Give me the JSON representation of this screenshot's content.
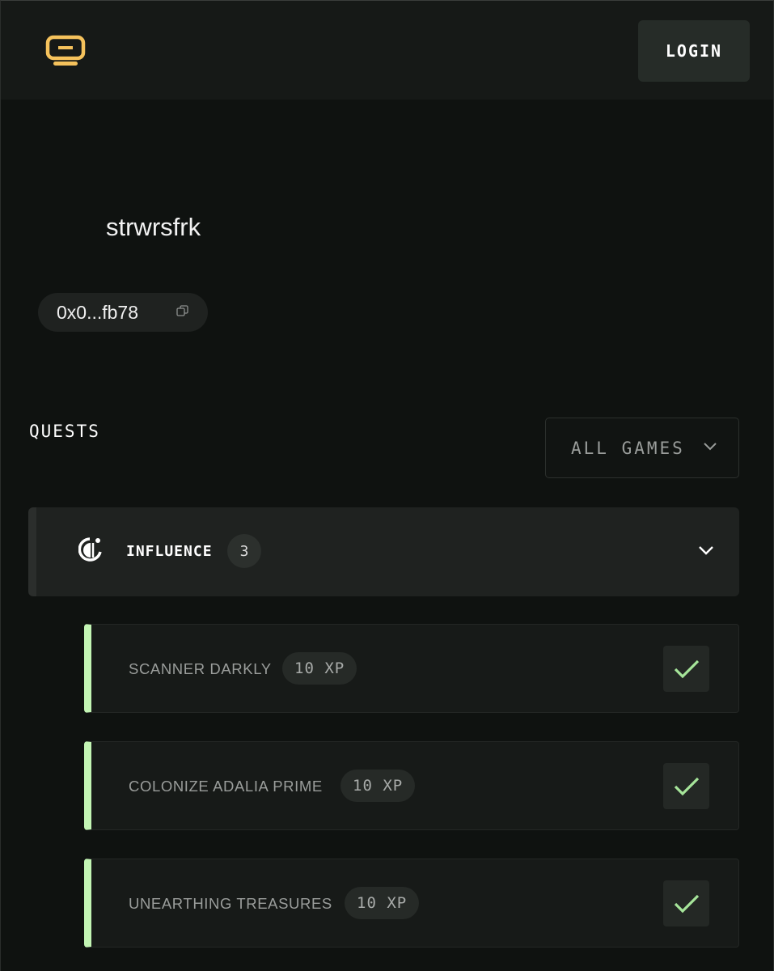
{
  "header": {
    "logo_icon": "monitor-logo-icon",
    "login_label": "LOGIN",
    "accent_color": "#f5c25c"
  },
  "profile": {
    "username": "strwrsfrk",
    "wallet_address": "0x0...fb78",
    "copy_icon": "copy-icon"
  },
  "quests": {
    "title": "QUESTS",
    "filter_label": "ALL GAMES",
    "groups": [
      {
        "name": "INFLUENCE",
        "count": "3",
        "icon": "influence-logo-icon",
        "items": [
          {
            "name": "SCANNER DARKLY",
            "xp": "10 XP",
            "completed": true
          },
          {
            "name": "COLONIZE ADALIA PRIME",
            "xp": "10 XP",
            "completed": true
          },
          {
            "name": "UNEARTHING TREASURES",
            "xp": "10 XP",
            "completed": true
          }
        ]
      }
    ]
  },
  "colors": {
    "background": "#0f1210",
    "complete_accent": "#c3f5b4",
    "check_color": "#a6e59a"
  }
}
